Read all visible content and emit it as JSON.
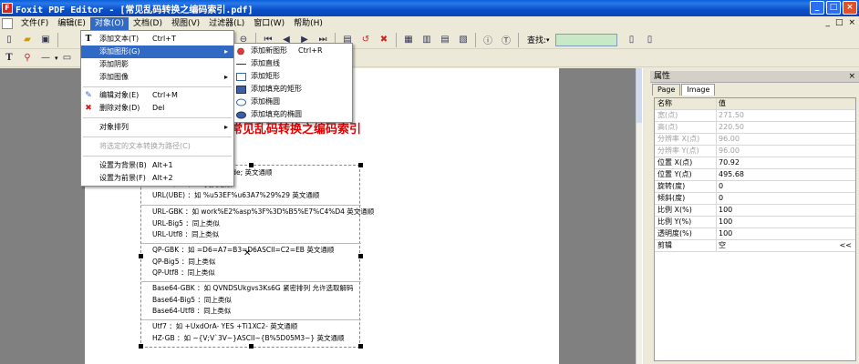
{
  "window": {
    "title": "Foxit PDF Editor - [常见乱码转换之编码索引.pdf]",
    "app_icon": "F"
  },
  "menubar": {
    "items": [
      "文件(F)",
      "编辑(E)",
      "对象(O)",
      "文档(D)",
      "视图(V)",
      "过滤器(L)",
      "窗口(W)",
      "帮助(H)"
    ],
    "mdi": [
      "_",
      "□",
      "×"
    ]
  },
  "toolbar": {
    "find_label": "查找:"
  },
  "dropdown": {
    "items": [
      {
        "label": "添加文本(T)",
        "shortcut": "Ctrl+T",
        "icon": "T"
      },
      {
        "label": "添加图形(G)",
        "arrow": "▸"
      },
      {
        "label": "添加阴影"
      },
      {
        "label": "添加图像",
        "arrow": "▸"
      },
      {
        "label": "编辑对象(E)",
        "shortcut": "Ctrl+M",
        "icon": "✎"
      },
      {
        "label": "删除对象(D)",
        "shortcut": "Del",
        "icon": "✖"
      },
      {
        "label": "对象排列",
        "arrow": "▸"
      },
      {
        "label": "将选定的文本转换为路径(C)"
      },
      {
        "label": "设置为背景(B)",
        "shortcut": "Alt+1"
      },
      {
        "label": "设置为前景(F)",
        "shortcut": "Alt+2"
      }
    ]
  },
  "submenu": {
    "items": [
      {
        "label": "添加新图形",
        "shortcut": "Ctrl+R"
      },
      {
        "label": "添加直线"
      },
      {
        "label": "添加矩形"
      },
      {
        "label": "添加填充的矩形"
      },
      {
        "label": "添加椭圆"
      },
      {
        "label": "添加填充的椭圆"
      }
    ]
  },
  "document": {
    "title": "常见乱码转换之编码索引",
    "groups": [
      [
        "...5511;&#ordm;&#Atilde; 英文通顺",
        "...3A7\\x28\\x29  英文通顺",
        "URL(UBE) ：如 %u53EF%u63A7%29%29 英文通顺"
      ],
      [
        "URL-GBK ：如 work%E2%asp%3F%3D%B5%E7%C4%D4 英文通顺",
        "URL-Big5 ：同上类似",
        "URL-Utf8 ：同上类似"
      ],
      [
        "QP-GBK ：如 =D6=A7=B3=D6ASCII=C2=EB 英文通顺",
        "QP-Big5 ：同上类似",
        "QP-Utf8 ：同上类似"
      ],
      [
        "Base64-GBK ：如 QVNDSUkgvs3Ks6G 紧密排列 允许选取解码",
        "Base64-Big5 ：同上类似",
        "Base64-Utf8 ：同上类似"
      ],
      [
        "Utf7 ：如 +UxdOrA- YES +Ti1XC2- 英文通顺",
        "HZ-GB ：如 ~{V;V`3V~}ASCII~{B%5D05M3~} 英文通顺"
      ]
    ]
  },
  "panel": {
    "title": "属性",
    "close": "×",
    "tabs": [
      "Page",
      "Image"
    ],
    "header": {
      "key": "名称",
      "value": "值"
    },
    "rows": [
      {
        "key": "宽(点)",
        "value": "271.50",
        "ro": true
      },
      {
        "key": "高(点)",
        "value": "220.50",
        "ro": true
      },
      {
        "key": "分辨率 X(点)",
        "value": "96.00",
        "ro": true
      },
      {
        "key": "分辨率 Y(点)",
        "value": "96.00",
        "ro": true
      },
      {
        "key": "位置 X(点)",
        "value": "70.92"
      },
      {
        "key": "位置 Y(点)",
        "value": "495.68"
      },
      {
        "key": "旋转(度)",
        "value": "0"
      },
      {
        "key": "倾斜(度)",
        "value": "0"
      },
      {
        "key": "比例 X(%)",
        "value": "100"
      },
      {
        "key": "比例 Y(%)",
        "value": "100"
      },
      {
        "key": "透明度(%)",
        "value": "100"
      },
      {
        "key": "剪辑",
        "value": "空",
        "extra": "<<"
      }
    ]
  }
}
